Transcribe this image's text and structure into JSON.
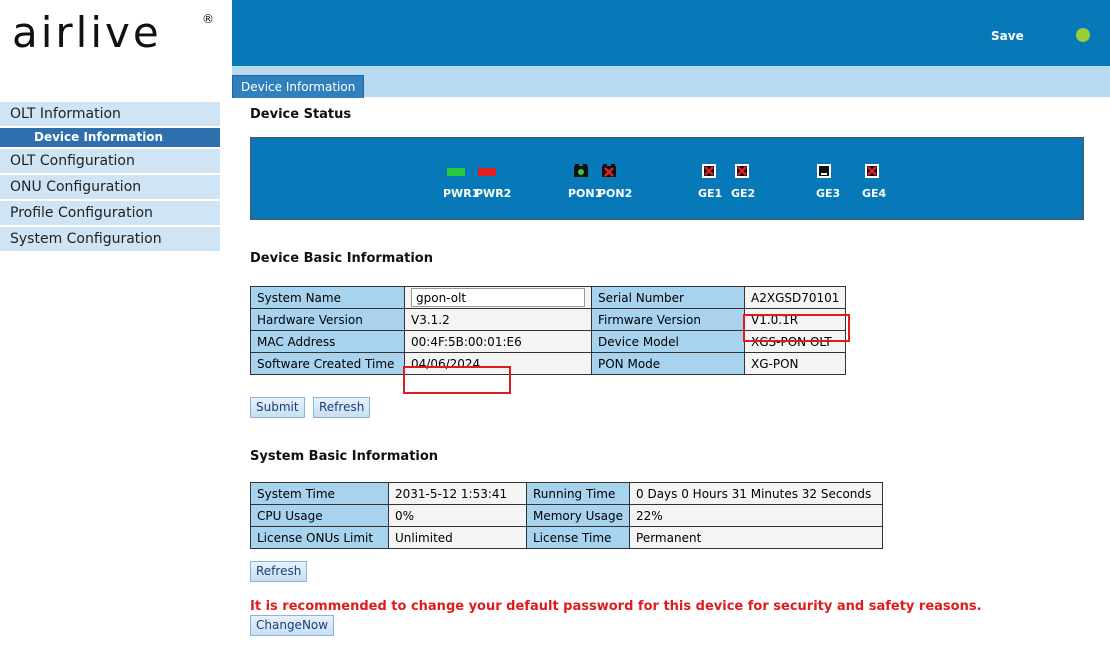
{
  "brand": {
    "logo_text": "airlive",
    "reg_mark": "®"
  },
  "header": {
    "save_label": "Save",
    "status_color": "#9acd3a"
  },
  "tabs": [
    {
      "label": "Device Information",
      "active": true
    }
  ],
  "sidebar": {
    "items": [
      {
        "label": "OLT Information"
      },
      {
        "label": "Device Information",
        "sub": true,
        "active": true
      },
      {
        "label": "OLT Configuration"
      },
      {
        "label": "ONU Configuration"
      },
      {
        "label": "Profile Configuration"
      },
      {
        "label": "System Configuration"
      }
    ]
  },
  "device_status": {
    "title": "Device Status",
    "ports": {
      "pwr1": "PWR1",
      "pwr2": "PWR2",
      "pon1": "PON1",
      "pon2": "PON2",
      "ge1": "GE1",
      "ge2": "GE2",
      "ge3": "GE3",
      "ge4": "GE4"
    },
    "colors": {
      "pwr1": "#28c840",
      "pwr2": "#e02020"
    }
  },
  "device_basic": {
    "title": "Device Basic Information",
    "system_name_label": "System Name",
    "system_name_value": "gpon-olt",
    "serial_label": "Serial Number",
    "serial_value": "A2XGSD70101",
    "hw_label": "Hardware Version",
    "hw_value": "V3.1.2",
    "fw_label": "Firmware Version",
    "fw_value": "V1.0.1R",
    "mac_label": "MAC Address",
    "mac_value": "00:4F:5B:00:01:E6",
    "model_label": "Device Model",
    "model_value": "XGS-PON OLT",
    "sw_time_label": "Software Created Time",
    "sw_time_value": "04/06/2024",
    "pon_mode_label": "PON Mode",
    "pon_mode_value": "XG-PON",
    "submit_label": "Submit",
    "refresh_label": "Refresh"
  },
  "system_basic": {
    "title": "System Basic Information",
    "system_time_label": "System Time",
    "system_time_value": "2031-5-12 1:53:41",
    "running_time_label": "Running Time",
    "running_time_value": "0 Days 0 Hours 31 Minutes 32 Seconds",
    "cpu_label": "CPU Usage",
    "cpu_value": "0%",
    "mem_label": "Memory Usage",
    "mem_value": "22%",
    "license_onus_label": "License ONUs Limit",
    "license_onus_value": "Unlimited",
    "license_time_label": "License Time",
    "license_time_value": "Permanent",
    "refresh_label": "Refresh"
  },
  "warning": {
    "text": "It is recommended to change your default password for this device for security and safety reasons.",
    "button_label": "ChangeNow"
  }
}
